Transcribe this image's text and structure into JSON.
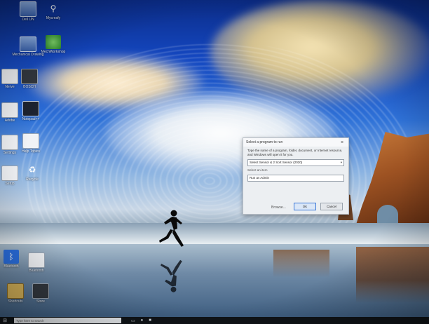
{
  "desktop": {
    "icons": [
      {
        "label": "Dell UN",
        "icon": "monitor-app-icon"
      },
      {
        "label": "Mycreafy",
        "icon": "usb-tool-icon"
      },
      {
        "label": "Mechanical Drawing",
        "icon": "monitor-app-icon"
      },
      {
        "label": "MechWorkshop",
        "icon": "green-app-icon"
      },
      {
        "label": "Nerve",
        "icon": "document-icon"
      },
      {
        "label": "BOSCH",
        "icon": "dark-app-icon"
      },
      {
        "label": "Notepad++",
        "icon": "circuit-board-icon"
      },
      {
        "label": "Help Topics",
        "icon": "document-icon"
      },
      {
        "label": "Adobe",
        "icon": "document-icon"
      },
      {
        "label": "Recycle",
        "icon": "recycle-bin-icon"
      },
      {
        "label": "Settings",
        "icon": "document-icon"
      },
      {
        "label": "Setup",
        "icon": "document-icon"
      },
      {
        "label": "Bluetooth",
        "icon": "bluetooth-icon"
      },
      {
        "label": "Bluetooth",
        "icon": "document-icon"
      },
      {
        "label": "Shortcuts",
        "icon": "folder-icon"
      },
      {
        "label": "Store",
        "icon": "dark-app-icon"
      }
    ]
  },
  "dialog": {
    "title": "Select a program to run",
    "message": "Type the name of a program, folder, document, or Internet resource, and Windows will open it for you.",
    "field_value": "Select Sensor & 2 Sort Sensor (2020)",
    "field_sub": "Select an item",
    "option_label": "Run as Admin",
    "browse_label": "Browse...",
    "ok_label": "OK",
    "cancel_label": "Cancel",
    "close_glyph": "×"
  },
  "taskbar": {
    "search_placeholder": "Type here to search",
    "start_glyph": "⊞"
  },
  "colors": {
    "sky_top": "#0b2c88",
    "cliff": "#9d5222",
    "dialog_bg": "#eceff2",
    "primary_button_border": "#3b78d8"
  }
}
